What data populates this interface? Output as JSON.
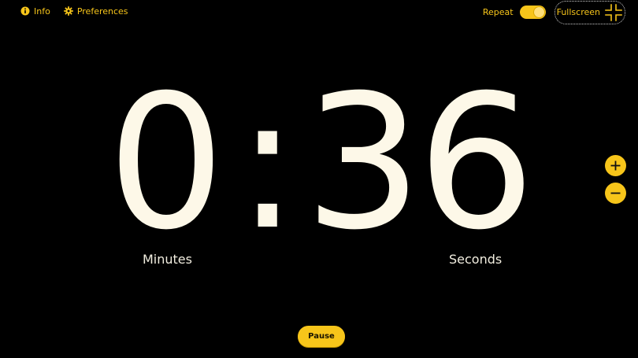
{
  "nav": {
    "info_label": "Info",
    "preferences_label": "Preferences",
    "repeat_label": "Repeat",
    "repeat_on": true,
    "fullscreen_label": "Fullscreen"
  },
  "timer": {
    "minutes": "0",
    "separator": ":",
    "seconds": "36",
    "minutes_label": "Minutes",
    "seconds_label": "Seconds"
  },
  "controls": {
    "pause_label": "Pause"
  },
  "colors": {
    "accent": "#f7c51a",
    "background": "#000000",
    "digits": "#fdf8e8"
  },
  "icons": {
    "info": "info-icon",
    "preferences": "gear-icon",
    "fullscreen": "fullscreen-exit-icon",
    "increase": "plus-icon",
    "decrease": "minus-icon"
  }
}
